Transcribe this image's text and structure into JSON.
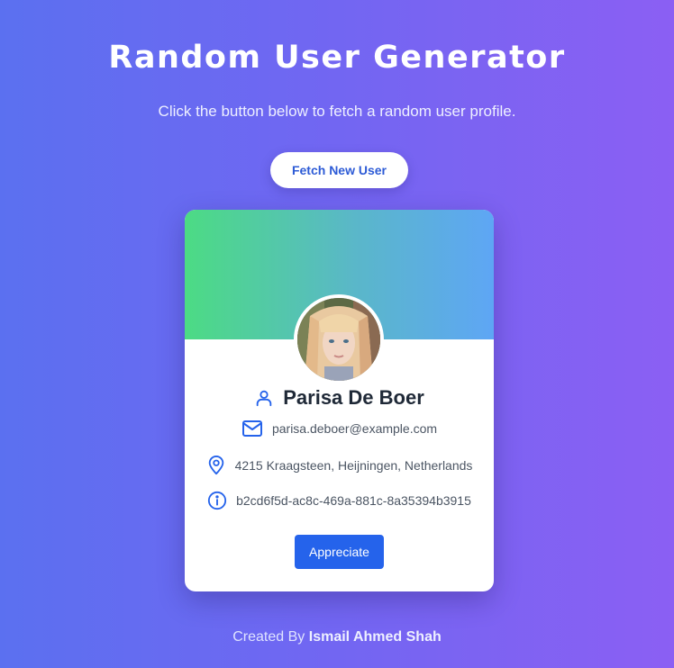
{
  "header": {
    "title": "Random User Generator",
    "subtitle": "Click the button below to fetch a random user profile.",
    "fetch_button_label": "Fetch New User"
  },
  "user": {
    "name": "Parisa De Boer",
    "email": "parisa.deboer@example.com",
    "address": "4215 Kraagsteen, Heijningen, Netherlands",
    "id": "b2cd6f5d-ac8c-469a-881c-8a35394b3915",
    "appreciate_label": "Appreciate"
  },
  "icons": {
    "name": "user-icon",
    "email": "mail-icon",
    "address": "map-pin-icon",
    "id": "info-icon"
  },
  "colors": {
    "accent": "#2563eb",
    "icon": "#2563eb",
    "header_gradient_start": "#4cdb84",
    "header_gradient_end": "#5ea6f5"
  },
  "footer": {
    "prefix": "Created By",
    "author": "Ismail Ahmed Shah"
  }
}
